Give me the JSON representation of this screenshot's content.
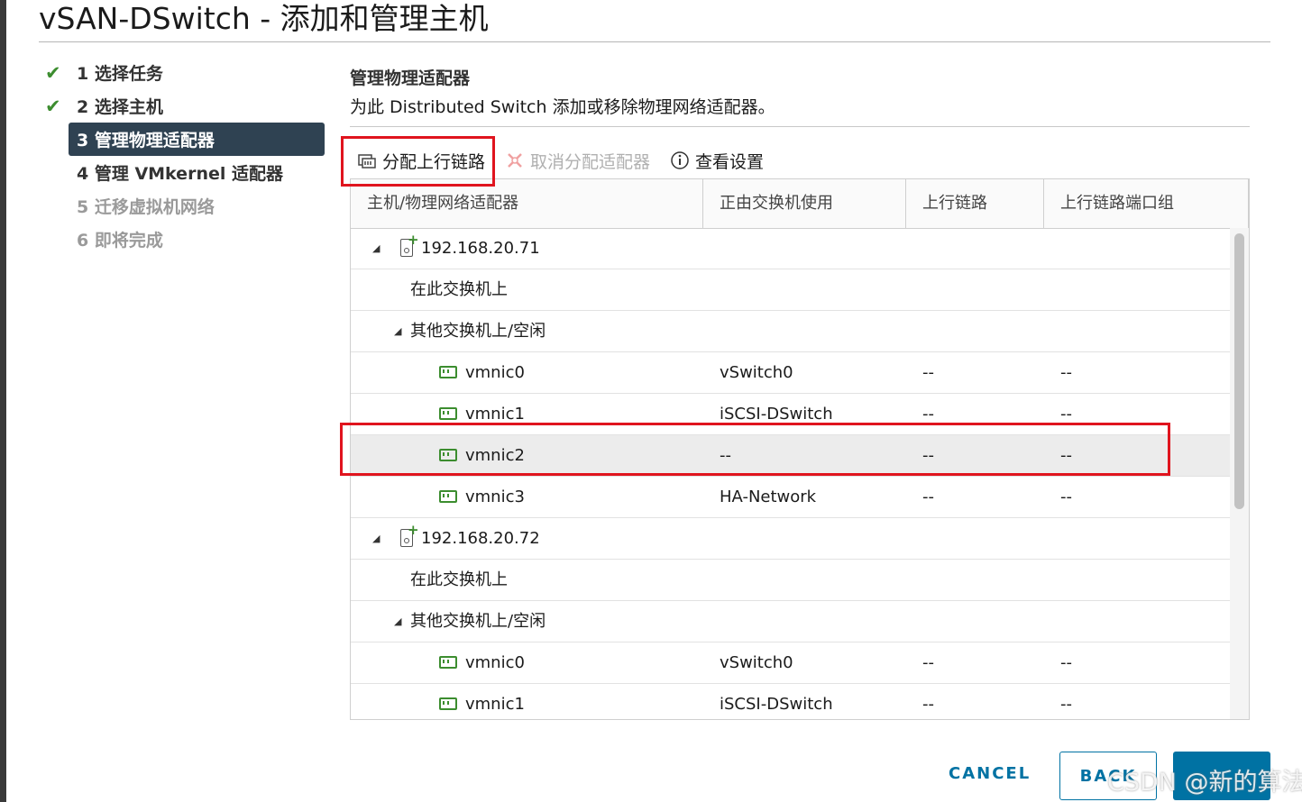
{
  "dialog": {
    "title": "vSAN-DSwitch - 添加和管理主机"
  },
  "steps": [
    {
      "label": "1 选择任务",
      "state": "done"
    },
    {
      "label": "2 选择主机",
      "state": "done"
    },
    {
      "label": "3 管理物理适配器",
      "state": "active"
    },
    {
      "label": "4 管理 VMkernel 适配器",
      "state": "pending"
    },
    {
      "label": "5 迁移虚拟机网络",
      "state": "disabled"
    },
    {
      "label": "6 即将完成",
      "state": "disabled"
    }
  ],
  "section": {
    "title": "管理物理适配器",
    "subtitle": "为此 Distributed Switch 添加或移除物理网络适配器。"
  },
  "toolbar": {
    "assign_uplink": "分配上行链路",
    "unassign_adapter": "取消分配适配器",
    "view_settings": "查看设置"
  },
  "table": {
    "columns": [
      "主机/物理网络适配器",
      "正由交换机使用",
      "上行链路",
      "上行链路端口组"
    ],
    "rows": [
      {
        "type": "host",
        "name": "192.168.20.71"
      },
      {
        "type": "group",
        "name": "在此交换机上"
      },
      {
        "type": "group-expand",
        "name": "其他交换机上/空闲"
      },
      {
        "type": "nic",
        "name": "vmnic0",
        "switch": "vSwitch0",
        "uplink": "--",
        "portgroup": "--"
      },
      {
        "type": "nic",
        "name": "vmnic1",
        "switch": "iSCSI-DSwitch",
        "uplink": "--",
        "portgroup": "--"
      },
      {
        "type": "nic",
        "name": "vmnic2",
        "switch": "--",
        "uplink": "--",
        "portgroup": "--",
        "selected": true
      },
      {
        "type": "nic",
        "name": "vmnic3",
        "switch": "HA-Network",
        "uplink": "--",
        "portgroup": "--"
      },
      {
        "type": "host",
        "name": "192.168.20.72"
      },
      {
        "type": "group",
        "name": "在此交换机上"
      },
      {
        "type": "group-expand",
        "name": "其他交换机上/空闲"
      },
      {
        "type": "nic",
        "name": "vmnic0",
        "switch": "vSwitch0",
        "uplink": "--",
        "portgroup": "--"
      },
      {
        "type": "nic",
        "name": "vmnic1",
        "switch": "iSCSI-DSwitch",
        "uplink": "--",
        "portgroup": "--"
      }
    ]
  },
  "footer": {
    "cancel": "CANCEL",
    "back": "BACK"
  },
  "watermark": "CSDN @新的算法",
  "colors": {
    "accent": "#0072a3",
    "active_step": "#2f4252",
    "check": "#3c8d2f",
    "highlight": "#e0141e"
  }
}
